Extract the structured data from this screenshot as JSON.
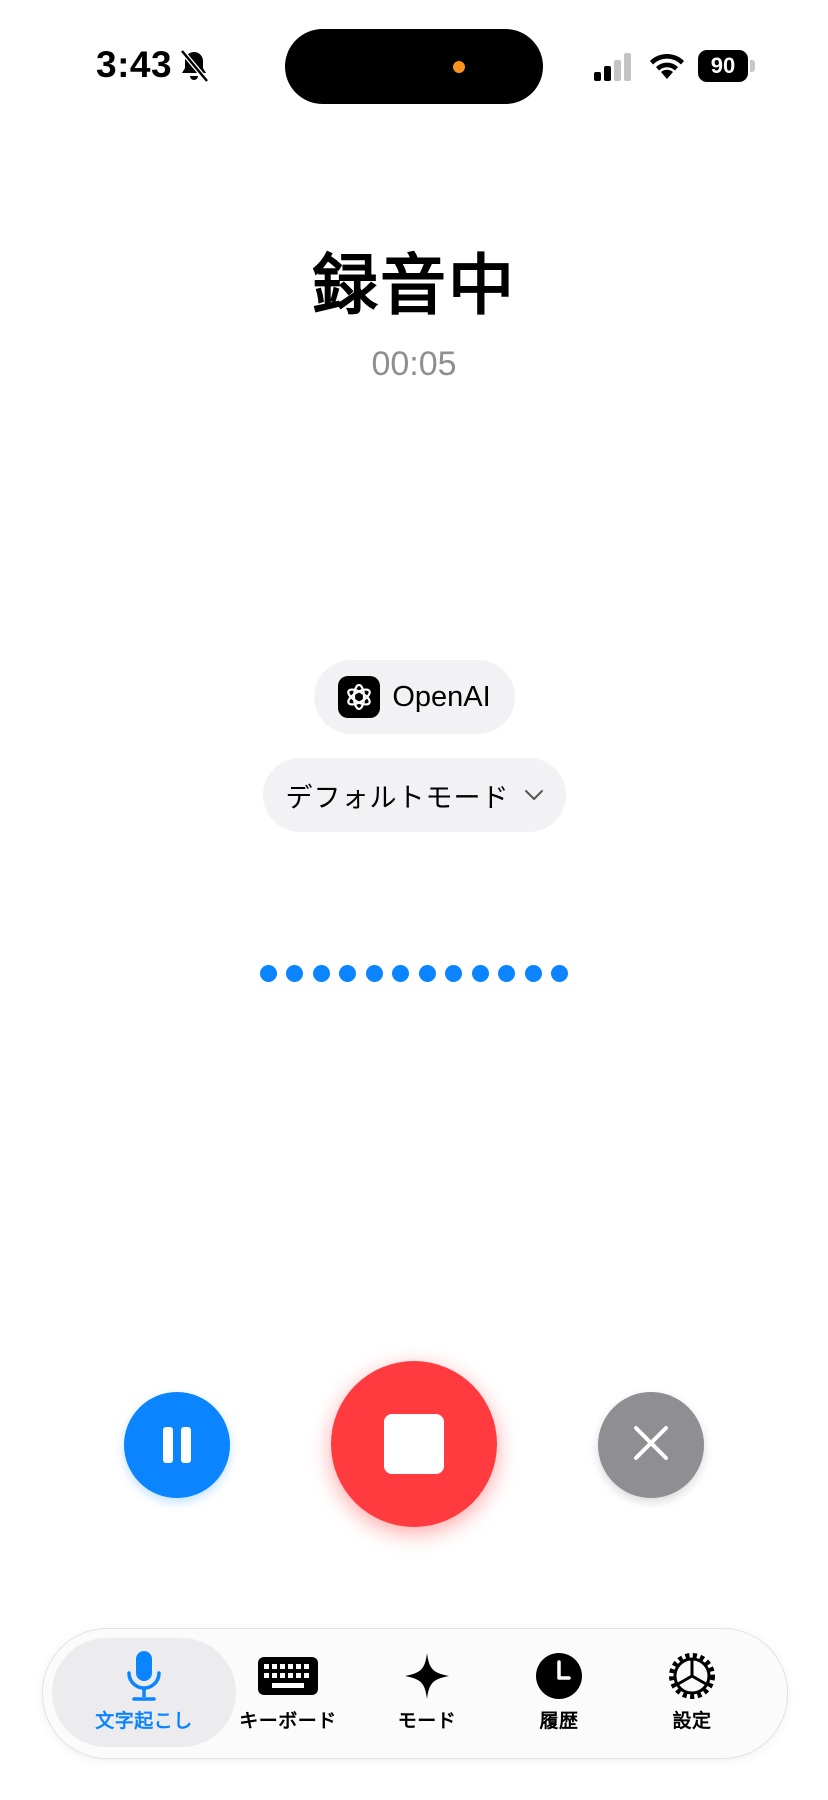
{
  "status_bar": {
    "time": "3:43",
    "battery": "90",
    "icons": [
      "bell-slash-icon",
      "cellular-signal-icon",
      "wifi-icon",
      "battery-icon"
    ]
  },
  "recording": {
    "title": "録音中",
    "elapsed": "00:05"
  },
  "provider": {
    "label": "OpenAI",
    "icon": "openai-logo-icon"
  },
  "mode_selector": {
    "label": "デフォルトモード",
    "icon": "chevron-down-icon"
  },
  "controls": {
    "pause_icon": "pause-icon",
    "stop_icon": "stop-icon",
    "cancel_icon": "close-icon"
  },
  "tab_bar": {
    "items": [
      {
        "label": "文字起こし",
        "icon": "microphone-icon",
        "active": true
      },
      {
        "label": "キーボード",
        "icon": "keyboard-icon",
        "active": false
      },
      {
        "label": "モード",
        "icon": "sparkle-icon",
        "active": false
      },
      {
        "label": "履歴",
        "icon": "clock-icon",
        "active": false
      },
      {
        "label": "設定",
        "icon": "gear-icon",
        "active": false
      }
    ]
  },
  "colors": {
    "accent": "#0a84ff",
    "stop": "#ff3b40",
    "cancel": "#8e8e93"
  }
}
